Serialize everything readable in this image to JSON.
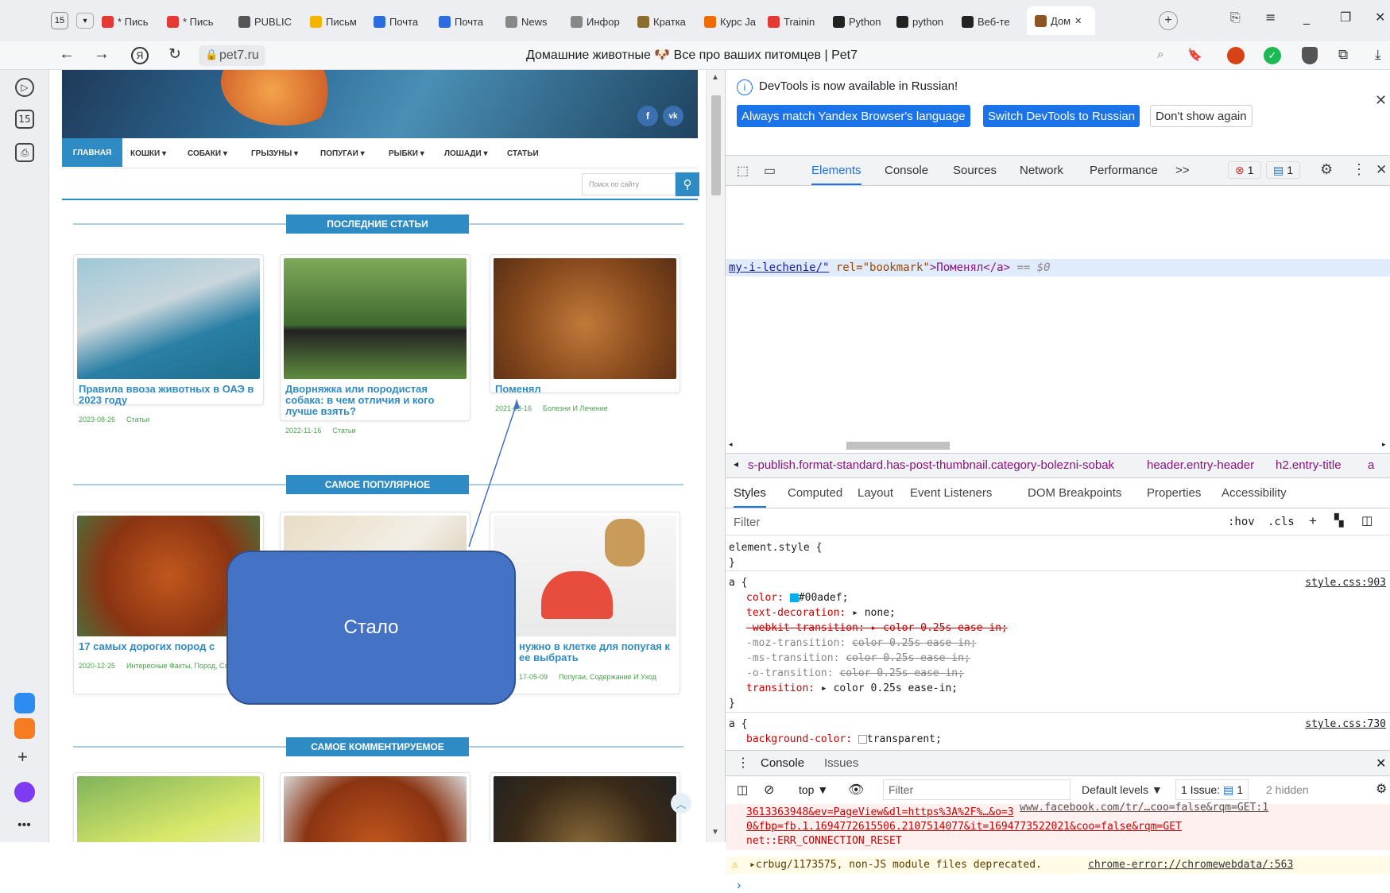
{
  "browser": {
    "tab_count_badge": "15",
    "tabs": [
      {
        "label": "* Пись",
        "color": "#e53935"
      },
      {
        "label": "* Пись",
        "color": "#e53935"
      },
      {
        "label": "PUBLIC",
        "color": "#555555"
      },
      {
        "label": "Письм",
        "color": "#f4b400"
      },
      {
        "label": "Почта",
        "color": "#2d6cdf"
      },
      {
        "label": "Почта",
        "color": "#2d6cdf"
      },
      {
        "label": "News",
        "color": "#888888"
      },
      {
        "label": "Инфор",
        "color": "#888888"
      },
      {
        "label": "Кратка",
        "color": "#8b6d2f"
      },
      {
        "label": "Курс Ja",
        "color": "#ef6c00"
      },
      {
        "label": "Trainin",
        "color": "#e53935"
      },
      {
        "label": "Python",
        "color": "#222222"
      },
      {
        "label": "python",
        "color": "#222222"
      },
      {
        "label": "Веб-те",
        "color": "#222222"
      },
      {
        "label": "Дом",
        "color": "#8d5524"
      }
    ],
    "new_tab": "+",
    "url": "pet7.ru",
    "page_title": "Домашние животные 🐶 Все про ваших питомцев | Pet7",
    "rail_badge": "15"
  },
  "site": {
    "social": [
      "f",
      "vk"
    ],
    "nav": {
      "home": "ГЛАВНАЯ",
      "items": [
        "КОШКИ ▾",
        "СОБАКИ ▾",
        "ГРЫЗУНЫ ▾",
        "ПОПУГАИ ▾",
        "РЫБКИ ▾",
        "ЛОШАДИ ▾",
        "СТАТЬИ"
      ]
    },
    "search_placeholder": "Поиск по сайту",
    "sections": {
      "latest": "ПОСЛЕДНИЕ СТАТЬИ",
      "popular": "САМОЕ ПОПУЛЯРНОЕ",
      "commented": "САМОЕ КОММЕНТИРУЕМОЕ"
    },
    "latest_cards": [
      {
        "title": "Правила ввоза животных в ОАЭ в 2023 году",
        "date": "2023-08-26",
        "tags": "Статьи"
      },
      {
        "title": "Дворняжка или породистая собака: в чем отличия и кого лучше взять?",
        "date": "2022-11-16",
        "tags": "Статьи"
      },
      {
        "title": "Поменял",
        "date": "2021-03-16",
        "tags": "Болезни И Лечение"
      }
    ],
    "popular_cards": [
      {
        "title": "17 самых дорогих пород с",
        "date": "2020-12-25",
        "tags": "Интересные Факты, Пород, Собаки"
      },
      {
        "title": "",
        "date": "",
        "tags": ""
      },
      {
        "title": "нужно в клетке для попугая к ее выбрать",
        "date": "17-05-09",
        "tags": "Попугаи, Содержание И Уход"
      }
    ],
    "callout": "Стало"
  },
  "devtools": {
    "banner_text": "DevTools is now available in Russian!",
    "banner_buttons": [
      "Always match Yandex Browser's language",
      "Switch DevTools to Russian",
      "Don't show again"
    ],
    "tabs": [
      "Elements",
      "Console",
      "Sources",
      "Network",
      "Performance",
      ">>"
    ],
    "error_count": "1",
    "issue_count": "1",
    "selected_node": {
      "href": "my-i-lechenie/\"",
      "attr": " rel=\"bookmark\"",
      "text": ">Поменял</a>",
      "marker": " == $0"
    },
    "breadcrumb": [
      "s-publish.format-standard.has-post-thumbnail.category-bolezni-sobak",
      "header.entry-header",
      "h2.entry-title",
      "a"
    ],
    "style_tabs": [
      "Styles",
      "Computed",
      "Layout",
      "Event Listeners",
      "DOM Breakpoints",
      "Properties",
      "Accessibility"
    ],
    "filter_placeholder": "Filter",
    "hov": ":hov",
    "cls": ".cls",
    "rules": {
      "element_style": "element.style {",
      "close": "}",
      "a_selector": "a {",
      "a_source": "style.css:903",
      "color_prop": "color:",
      "color_val": "#00adef;",
      "textdec_prop": "text-decoration:",
      "textdec_val": "▸ none;",
      "webkit_line": "-webkit-transition: ▸ color 0.25s ease-in;",
      "moz_prop": "-moz-transition:",
      "moz_val": "color 0.25s ease-in;",
      "ms_prop": "-ms-transition:",
      "ms_val": "color 0.25s ease-in;",
      "o_prop": "-o-transition:",
      "o_val": "color 0.25s ease-in;",
      "trans_prop": "transition:",
      "trans_val": "▸ color 0.25s ease-in;",
      "a2_selector": "a {",
      "a2_source": "style.css:730",
      "bg_prop": "background-color:",
      "bg_val": "transparent;"
    },
    "console": {
      "tabs": [
        "Console",
        "Issues"
      ],
      "context": "top ▼",
      "filter": "Filter",
      "levels": "Default levels ▼",
      "issues": "1 Issue:",
      "issues_count": "1",
      "hidden": "2 hidden",
      "err_line1": "3613363948&ev=PageView&dl=https%3A%2F%…&o=3",
      "err_link": "www.facebook.com/tr/…coo=false&rqm=GET:1",
      "err_line2": "0&fbp=fb.1.1694772615506.2107514077&it=1694773522021&coo=false&rqm=GET",
      "err_line3": "net::ERR_CONNECTION_RESET",
      "warn_text": "▸crbug/1173575, non-JS module files deprecated.",
      "warn_link": "chrome-error://chromewebdata/:563",
      "prompt": "›"
    }
  }
}
